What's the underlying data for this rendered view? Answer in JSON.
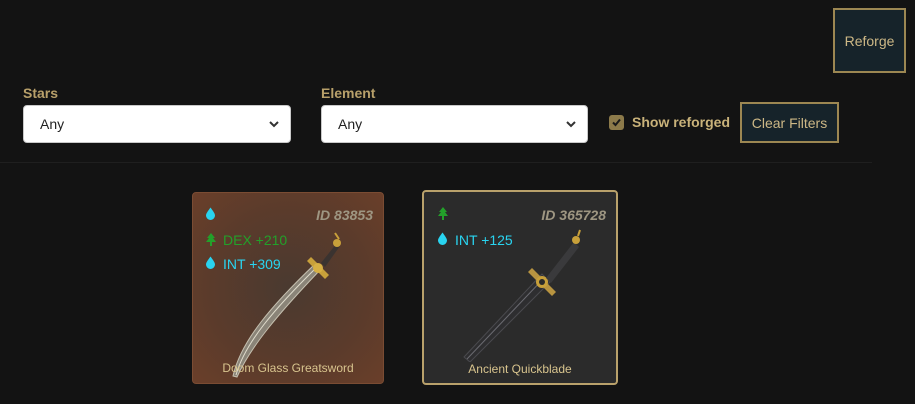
{
  "toolbar": {
    "reforge_label": "Reforge"
  },
  "filters": {
    "stars": {
      "label": "Stars",
      "value": "Any"
    },
    "element": {
      "label": "Element",
      "value": "Any"
    },
    "show_reforged": {
      "label": "Show reforged",
      "checked": true
    },
    "clear_label": "Clear Filters"
  },
  "weapons": [
    {
      "id_label": "ID 83853",
      "name": "Doom Glass Greatsword",
      "element_icon": "water-drop-icon",
      "selected": false,
      "stats": [
        {
          "icon": "tree-icon",
          "text": "DEX +210"
        },
        {
          "icon": "water-drop-icon",
          "text": "INT +309"
        }
      ]
    },
    {
      "id_label": "ID 365728",
      "name": "Ancient Quickblade",
      "element_icon": "tree-icon",
      "selected": true,
      "stats": [
        {
          "icon": "water-drop-icon",
          "text": "INT +125"
        }
      ]
    }
  ],
  "colors": {
    "background": "#131313",
    "accent_gold": "#b9a16b",
    "dex_green": "#23a02a",
    "int_cyan": "#29d4f0"
  }
}
